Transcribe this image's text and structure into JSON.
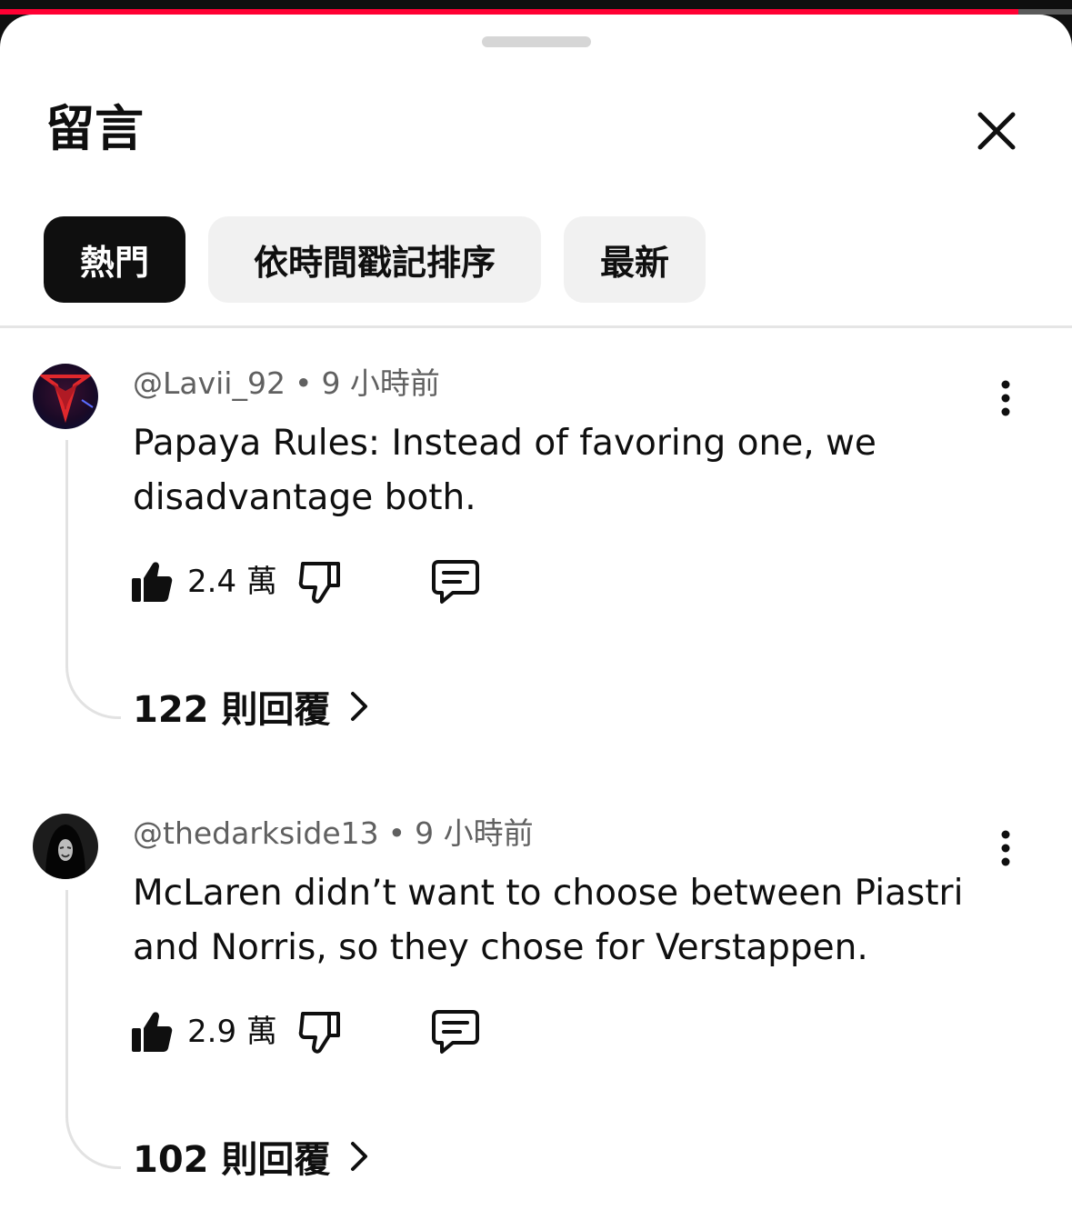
{
  "video_progress": 0.95,
  "colors": {
    "progress_played": "#ff0033",
    "active_chip_bg": "#0f0f0f",
    "chip_bg": "#f1f1f1",
    "meta_text": "#606060"
  },
  "panel": {
    "title": "留言",
    "close_icon": "close-icon"
  },
  "sort_chips": [
    {
      "label": "熱門",
      "active": true
    },
    {
      "label": "依時間戳記排序",
      "active": false
    },
    {
      "label": "最新",
      "active": false
    }
  ],
  "comments": [
    {
      "author": "@Lavii_92",
      "time": "9 小時前",
      "text": "Papaya Rules: Instead of favoring one, we disadvantage both.",
      "likes": "2.4 萬",
      "replies": "122 則回覆",
      "avatar_icon": "red-emblem-avatar"
    },
    {
      "author": "@thedarkside13",
      "time": "9 小時前",
      "text": "McLaren didn’t want to choose between Piastri and Norris, so they chose for Verstappen.",
      "likes": "2.9 萬",
      "replies": "102 則回覆",
      "avatar_icon": "hooded-figure-avatar"
    }
  ],
  "actions": {
    "like_icon": "thumbs-up-icon",
    "dislike_icon": "thumbs-down-icon",
    "reply_icon": "comment-icon",
    "more_icon": "more-vert-icon",
    "chevron_icon": "chevron-right-icon"
  }
}
